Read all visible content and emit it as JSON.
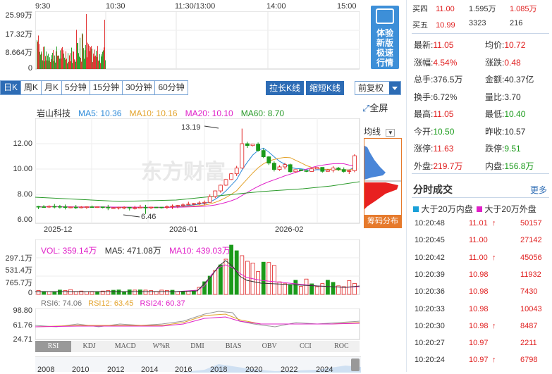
{
  "timeline": {
    "ticks": [
      "9:30",
      "10:30",
      "11:30/13:00",
      "14:00",
      "15:00"
    ],
    "ylabels": [
      "25.99万",
      "17.32万",
      "8.664万",
      "0"
    ]
  },
  "promo": {
    "text1": "体验",
    "text2": "新版",
    "text3": "极速",
    "text4": "行情"
  },
  "tabs": [
    {
      "label": "日K",
      "active": true
    },
    {
      "label": "周K"
    },
    {
      "label": "月K"
    },
    {
      "label": "5分钟"
    },
    {
      "label": "15分钟"
    },
    {
      "label": "30分钟"
    },
    {
      "label": "60分钟"
    }
  ],
  "buttons": {
    "stretch": "拉长K线",
    "shrink": "缩短K线",
    "adjust": "前复权"
  },
  "fullscreen": "全屏",
  "ma": {
    "name": "岩山科技",
    "ma5": "MA5: 10.36",
    "ma10": "MA10: 10.16",
    "ma20": "MA20: 10.10",
    "ma60": "MA60: 8.70"
  },
  "colors": {
    "ma5": "#2d8ad8",
    "ma10": "#e3a22a",
    "ma20": "#e020c8",
    "ma60": "#2a9a2a",
    "up": "#e02020",
    "down": "#1a9a1a"
  },
  "kchart": {
    "ylabels": [
      "12.00",
      "10.00",
      "8.00",
      "6.00"
    ],
    "xlabels": [
      "2025-12",
      "2026-01",
      "2026-02"
    ],
    "high_label": "13.19",
    "low_label": "6.46",
    "watermark": "东方财富"
  },
  "junxian": "均线",
  "chip_label": "筹码分布",
  "volume": {
    "vol": "VOL: 359.14万",
    "ma5": "MA5: 471.08万",
    "ma10": "MA10: 439.03万",
    "ylabels": [
      "297.1万",
      "531.4万",
      "765.7万",
      "0"
    ]
  },
  "rsi": {
    "rsi6": "RSI6: 74.06",
    "rsi12": "RSI12: 63.45",
    "rsi24": "RSI24: 60.37",
    "ylabels": [
      "98.80",
      "61.76",
      "24.71"
    ]
  },
  "indicators": [
    "RSI",
    "KDJ",
    "MACD",
    "W%R",
    "DMI",
    "BIAS",
    "OBV",
    "CCI",
    "ROC"
  ],
  "years": [
    "2008",
    "2010",
    "2012",
    "2014",
    "2016",
    "2018",
    "2020",
    "2022",
    "2024"
  ],
  "quote": {
    "buy4": {
      "label": "买四",
      "price": "11.00",
      "vol": "1.595万",
      "amt": "1.085万"
    },
    "buy5": {
      "label": "买五",
      "price": "10.99",
      "vol": "3323",
      "amt": "216"
    },
    "rows": [
      [
        {
          "k": "最新:",
          "v": "11.05",
          "c": "red"
        },
        {
          "k": "均价:",
          "v": "10.72",
          "c": "red"
        }
      ],
      [
        {
          "k": "涨幅:",
          "v": "4.54%",
          "c": "red"
        },
        {
          "k": "涨跌:",
          "v": "0.48",
          "c": "red"
        }
      ],
      [
        {
          "k": "总手:",
          "v": "376.5万",
          "c": ""
        },
        {
          "k": "金额:",
          "v": "40.37亿",
          "c": ""
        }
      ],
      [
        {
          "k": "换手:",
          "v": "6.72%",
          "c": ""
        },
        {
          "k": "量比:",
          "v": "3.70",
          "c": ""
        }
      ],
      [
        {
          "k": "最高:",
          "v": "11.05",
          "c": "red"
        },
        {
          "k": "最低:",
          "v": "10.40",
          "c": "green"
        }
      ],
      [
        {
          "k": "今开:",
          "v": "10.50",
          "c": "green"
        },
        {
          "k": "昨收:",
          "v": "10.57",
          "c": ""
        }
      ],
      [
        {
          "k": "涨停:",
          "v": "11.63",
          "c": "red"
        },
        {
          "k": "跌停:",
          "v": "9.51",
          "c": "green"
        }
      ],
      [
        {
          "k": "外盘:",
          "v": "219.7万",
          "c": "red"
        },
        {
          "k": "内盘:",
          "v": "156.8万",
          "c": "green"
        }
      ]
    ]
  },
  "ticks_title": "分时成交",
  "more": "更多",
  "legend": {
    "inner": "大于20万内盘",
    "outer": "大于20万外盘"
  },
  "trades": [
    {
      "time": "10:20:48",
      "price": "11.01",
      "dir": "up",
      "vol": "50157"
    },
    {
      "time": "10:20:45",
      "price": "11.00",
      "dir": "",
      "vol": "27142"
    },
    {
      "time": "10:20:42",
      "price": "11.00",
      "dir": "up",
      "vol": "45056"
    },
    {
      "time": "10:20:39",
      "price": "10.98",
      "dir": "",
      "vol": "11932"
    },
    {
      "time": "10:20:36",
      "price": "10.98",
      "dir": "",
      "vol": "7430"
    },
    {
      "time": "10:20:33",
      "price": "10.98",
      "dir": "",
      "vol": "10043"
    },
    {
      "time": "10:20:30",
      "price": "10.98",
      "dir": "up",
      "vol": "8487"
    },
    {
      "time": "10:20:27",
      "price": "10.97",
      "dir": "",
      "vol": "2211"
    },
    {
      "time": "10:20:24",
      "price": "10.97",
      "dir": "up",
      "vol": "6798"
    }
  ]
}
